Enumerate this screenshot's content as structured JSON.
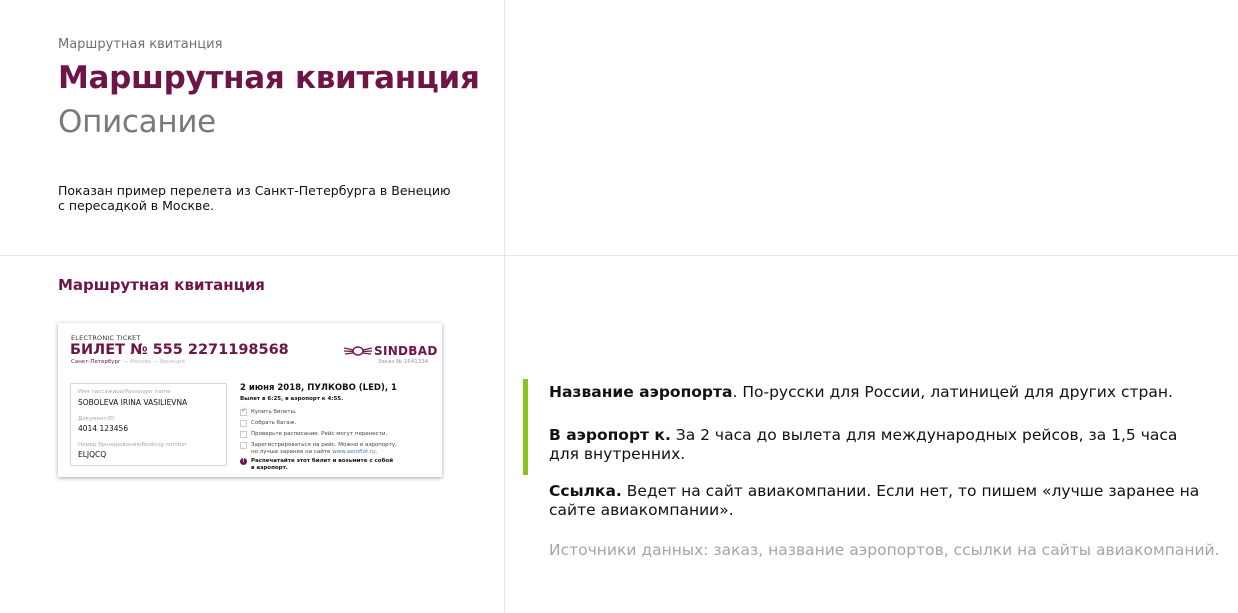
{
  "header": {
    "breadcrumb": "Маршрутная квитанция",
    "title": "Маршрутная квитанция",
    "subtitle": "Описание",
    "description_line1": "Показан пример перелета из Санкт-Петербурга в Венецию",
    "description_line2": "с пересадкой в Москве."
  },
  "section": {
    "title": "Маршрутная квитанция"
  },
  "ticket": {
    "label": "ELECTRONIC TICKET",
    "number": "БИЛЕТ № 555 2271198568",
    "route_from": "Санкт-Петербург",
    "route_rest": " — Москва — Венеция",
    "logo_text": "SINDBAD",
    "order": "Заказ № 1641334",
    "passenger_label": "Имя пассажира/Passenger name",
    "passenger_name": "SOBOLEVA IRINA VASILIEVNA",
    "doc_label": "Документ/ID",
    "doc_number": "4014 123456",
    "booking_label": "Номер бронирования/Booking number",
    "booking_number": "ELJQCQ",
    "flight": "2 июня 2018, ПУЛКОВО (LED), 1",
    "departure": "Вылет в 6:25, в аэропорт к 4:55.",
    "checklist": [
      "Купить билеты.",
      "Собрать багаж.",
      "Проверьте расписание. Рейс могут перенести.",
      "Зарегистрироваться на рейс. Можно в аэропорту,"
    ],
    "checklist_cont": "но лучше заранее на сайте ",
    "checklist_link": "www.aeroflot.ru",
    "checklist_end": ".",
    "warning_icon": "!",
    "warning_line1": "Распечатайте этот билет и возьмите с собой",
    "warning_line2": "в аэропорт."
  },
  "notes": [
    {
      "bold": "Название аэропорта",
      "text": ". По-русски для России, латиницей для других стран."
    },
    {
      "bold": "В аэропорт к.",
      "text": " За 2 часа до вылета для международных рейсов, за 1,5 часа для внутренних."
    },
    {
      "bold": "Ссылка.",
      "text": " Ведет на сайт авиакомпании. Если нет, то пишем «лучше заранее на сайте авиакомпании»."
    }
  ],
  "sources": "Источники данных: заказ, название аэропортов, ссылки на сайты авиакомпаний.",
  "colors": {
    "brand": "#6e1548",
    "accent": "#8bc21c",
    "muted": "#7a7a7a"
  },
  "icons": {
    "logo": "sindbad-wings-logo",
    "check": "checkmark",
    "warning": "exclamation-circle"
  }
}
